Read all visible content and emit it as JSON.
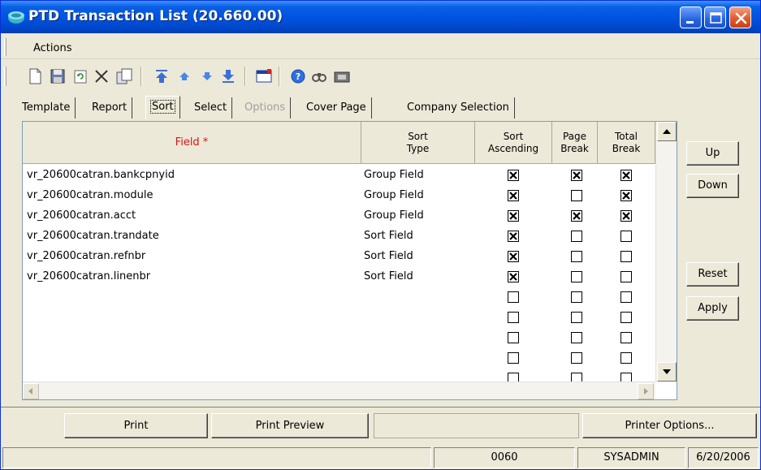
{
  "window": {
    "title": "PTD Transaction List (20.660.00)"
  },
  "menu": {
    "actions_label": "Actions"
  },
  "toolbar": {
    "icons": [
      "new-document-icon",
      "save-icon",
      "refresh-icon",
      "delete-icon",
      "copy-icon",
      "first-record-icon",
      "previous-record-icon",
      "next-record-icon",
      "last-record-icon",
      "customize-window-icon",
      "help-icon",
      "find-icon",
      "note-icon"
    ]
  },
  "tabs": [
    {
      "label": "Template",
      "state": "normal"
    },
    {
      "label": "Report",
      "state": "normal"
    },
    {
      "label": "Sort",
      "state": "active"
    },
    {
      "label": "Select",
      "state": "normal"
    },
    {
      "label": "Options",
      "state": "disabled"
    },
    {
      "label": "Cover Page",
      "state": "normal"
    },
    {
      "label": "Company Selection",
      "state": "normal"
    }
  ],
  "grid": {
    "headers": {
      "field": "Field *",
      "sort_type_1": "Sort",
      "sort_type_2": "Type",
      "sort_asc_1": "Sort",
      "sort_asc_2": "Ascending",
      "page_break_1": "Page",
      "page_break_2": "Break",
      "total_break_1": "Total",
      "total_break_2": "Break"
    },
    "rows": [
      {
        "field": "vr_20600catran.bankcpnyid",
        "sort_type": "Group Field",
        "sort_ascending": true,
        "page_break": true,
        "total_break": true
      },
      {
        "field": "vr_20600catran.module",
        "sort_type": "Group Field",
        "sort_ascending": true,
        "page_break": false,
        "total_break": true
      },
      {
        "field": "vr_20600catran.acct",
        "sort_type": "Group Field",
        "sort_ascending": true,
        "page_break": true,
        "total_break": true
      },
      {
        "field": "vr_20600catran.trandate",
        "sort_type": "Sort Field",
        "sort_ascending": true,
        "page_break": false,
        "total_break": false
      },
      {
        "field": "vr_20600catran.refnbr",
        "sort_type": "Sort Field",
        "sort_ascending": true,
        "page_break": false,
        "total_break": false
      },
      {
        "field": "vr_20600catran.linenbr",
        "sort_type": "Sort Field",
        "sort_ascending": true,
        "page_break": false,
        "total_break": false
      },
      {
        "field": "",
        "sort_type": "",
        "sort_ascending": false,
        "page_break": false,
        "total_break": false
      },
      {
        "field": "",
        "sort_type": "",
        "sort_ascending": false,
        "page_break": false,
        "total_break": false
      },
      {
        "field": "",
        "sort_type": "",
        "sort_ascending": false,
        "page_break": false,
        "total_break": false
      },
      {
        "field": "",
        "sort_type": "",
        "sort_ascending": false,
        "page_break": false,
        "total_break": false
      },
      {
        "field": "",
        "sort_type": "",
        "sort_ascending": false,
        "page_break": false,
        "total_break": false
      }
    ]
  },
  "side_buttons": {
    "up": "Up",
    "down": "Down",
    "reset": "Reset",
    "apply": "Apply"
  },
  "bottom_buttons": {
    "print": "Print",
    "print_preview": "Print Preview",
    "printer_options": "Printer Options..."
  },
  "status": {
    "code": "0060",
    "user": "SYSADMIN",
    "date": "6/20/2006"
  },
  "colors": {
    "title_blue": "#0054e3",
    "required_field_red": "#e01010"
  }
}
